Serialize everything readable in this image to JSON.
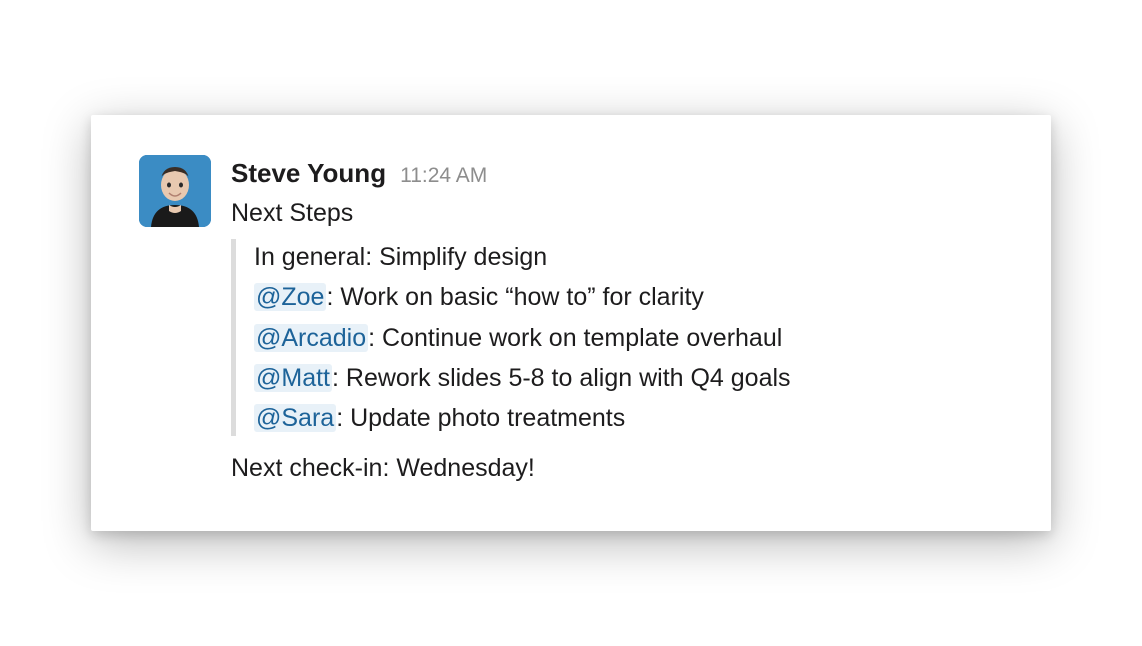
{
  "message": {
    "sender": "Steve Young",
    "timestamp": "11:24 AM",
    "intro": "Next Steps",
    "quote": {
      "general": "In general: Simplify design",
      "items": [
        {
          "mention": "@Zoe",
          "text": ": Work on basic “how to” for clarity"
        },
        {
          "mention": "@Arcadio",
          "text": ": Continue work on template overhaul"
        },
        {
          "mention": "@Matt",
          "text": ": Rework slides 5-8 to align with Q4 goals"
        },
        {
          "mention": "@Sara",
          "text": ": Update photo treatments"
        }
      ]
    },
    "closing": "Next check-in: Wednesday!"
  },
  "colors": {
    "mention_bg": "#e8f1f8",
    "mention_fg": "#1d6399",
    "avatar_bg": "#3b8cc4"
  }
}
